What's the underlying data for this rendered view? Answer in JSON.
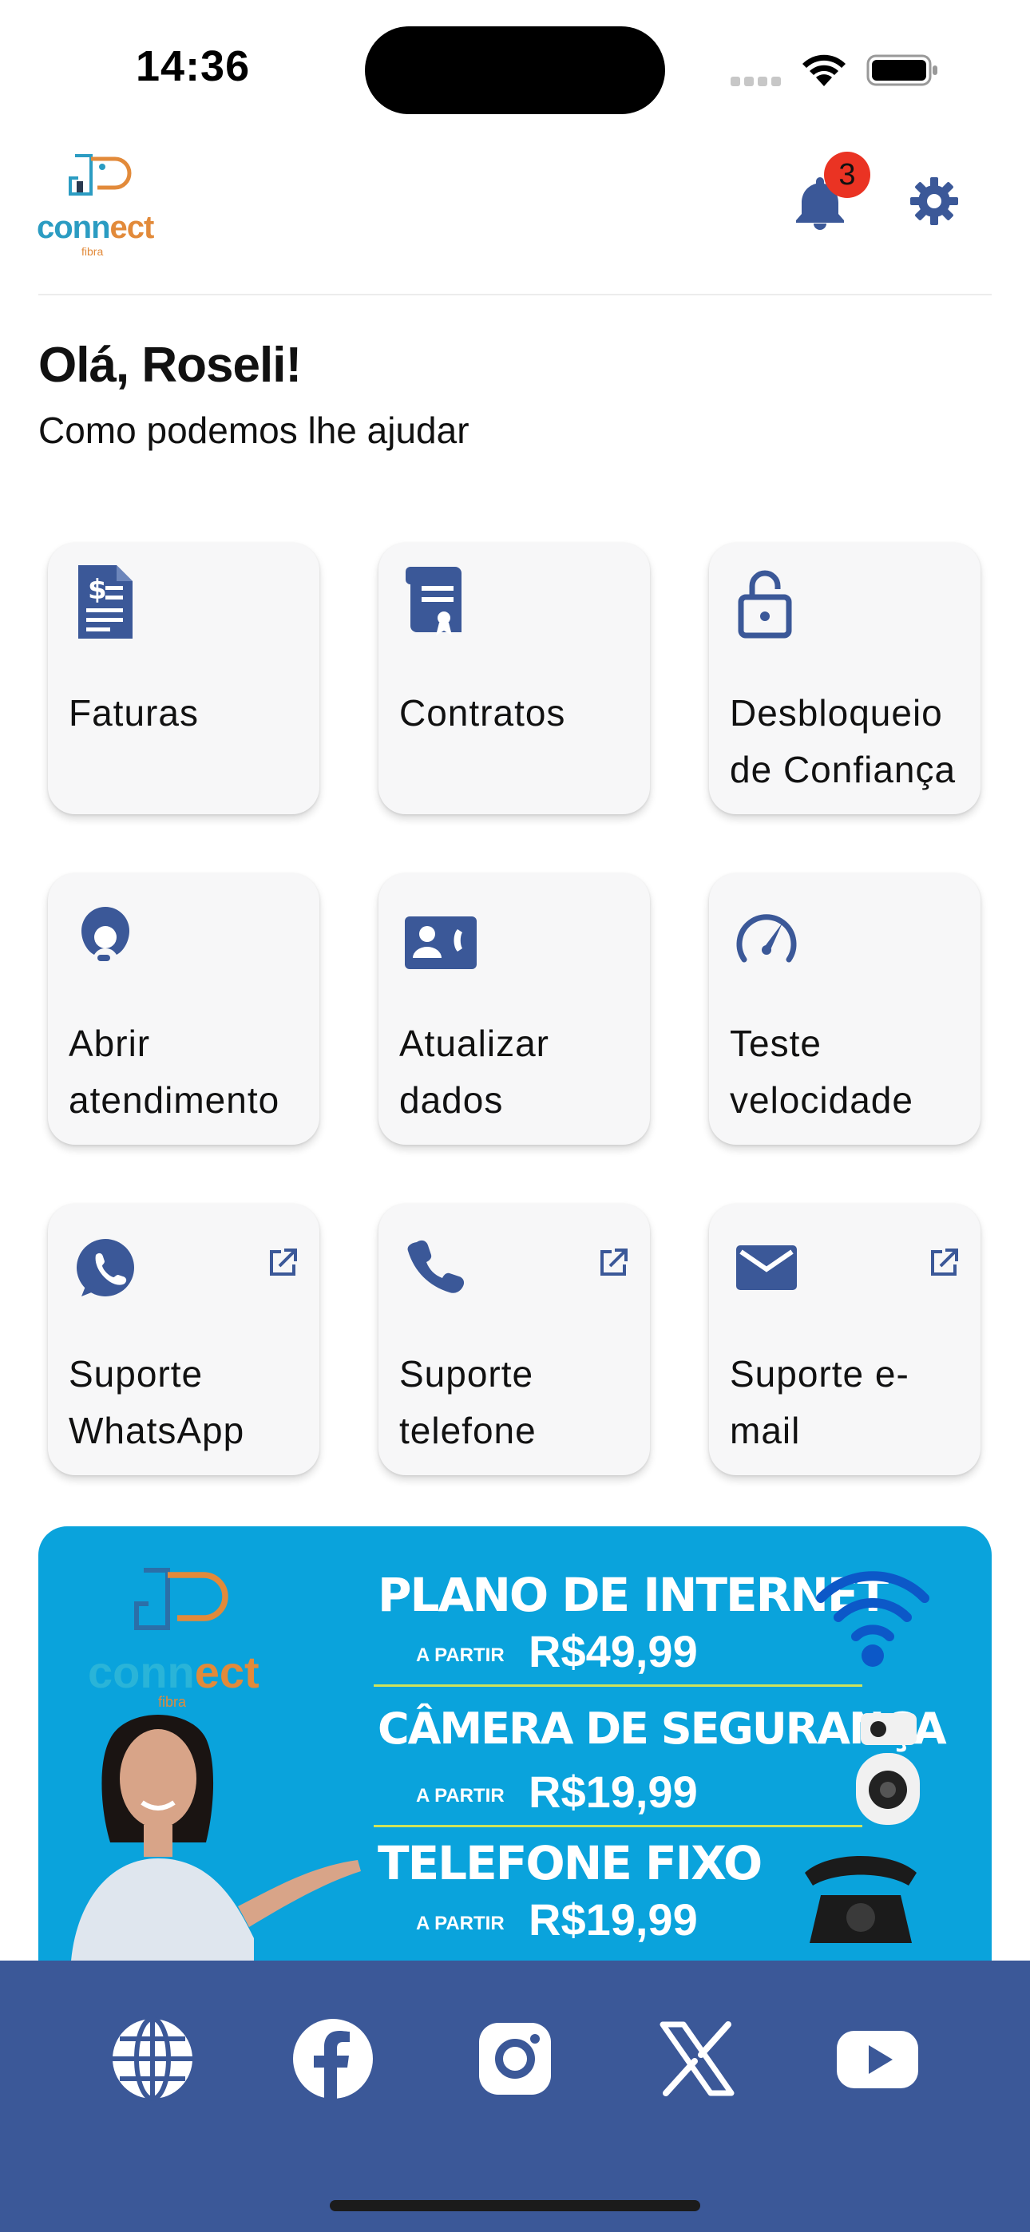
{
  "status_bar": {
    "time": "14:36"
  },
  "header": {
    "logo_text_1": "conn",
    "logo_text_2": "ect",
    "logo_sub": "fibra",
    "notification_count": "3"
  },
  "greeting": {
    "title": "Olá, Roseli!",
    "subtitle": "Como podemos lhe ajudar"
  },
  "tiles": [
    {
      "label": "Faturas",
      "icon": "invoice-icon"
    },
    {
      "label": "Contratos",
      "icon": "contract-icon"
    },
    {
      "label": "Desbloqueio de Confiança",
      "icon": "unlock-icon"
    },
    {
      "label": "Abrir atendimento",
      "icon": "support-agent-icon"
    },
    {
      "label": "Atualizar dados",
      "icon": "contact-card-icon"
    },
    {
      "label": "Teste velocidade",
      "icon": "speedometer-icon"
    },
    {
      "label": "Suporte WhatsApp",
      "icon": "whatsapp-icon",
      "external": true
    },
    {
      "label": "Suporte telefone",
      "icon": "phone-icon",
      "external": true
    },
    {
      "label": "Suporte e-mail",
      "icon": "email-icon",
      "external": true
    }
  ],
  "banner": {
    "line1_title": "PLANO DE INTERNET",
    "line1_from": "A PARTIR",
    "line1_price": "R$49,99",
    "line2_title": "CÂMERA DE SEGURANÇA",
    "line2_from": "A PARTIR",
    "line2_price": "R$19,99",
    "line3_title": "TELEFONE FIXO",
    "line3_from": "A PARTIR",
    "line3_price": "R$19,99",
    "logo_text_1": "conn",
    "logo_text_2": "ect",
    "logo_sub": "fibra"
  },
  "footer": {
    "links": [
      "globe-icon",
      "facebook-icon",
      "instagram-icon",
      "x-icon",
      "youtube-icon"
    ]
  },
  "colors": {
    "primary": "#3b5898",
    "banner": "#0aa3dc",
    "badge": "#ea3323",
    "tile_bg": "#f7f7f8"
  }
}
